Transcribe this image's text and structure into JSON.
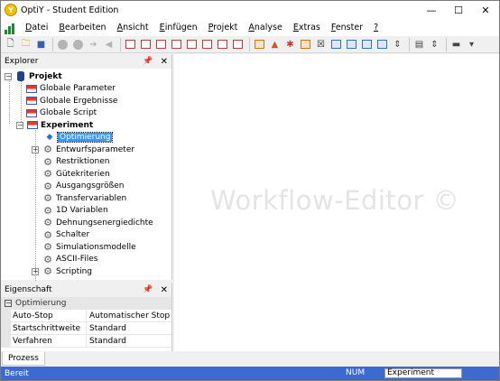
{
  "window": {
    "title": "OptiY - Student Edition",
    "minimize": "—",
    "maximize": "☐",
    "close": "✕"
  },
  "menu": {
    "items": [
      {
        "acc": "D",
        "rest": "atei"
      },
      {
        "acc": "B",
        "rest": "earbeiten"
      },
      {
        "acc": "A",
        "rest": "nsicht"
      },
      {
        "acc": "E",
        "rest": "infügen"
      },
      {
        "acc": "P",
        "rest": "rojekt"
      },
      {
        "acc": "A",
        "rest": "nalyse"
      },
      {
        "acc": "E",
        "rest": "xtras"
      },
      {
        "acc": "F",
        "rest": "enster"
      },
      {
        "acc": "?",
        "rest": ""
      }
    ]
  },
  "explorer": {
    "title": "Explorer",
    "pin": "📌",
    "close": "✕",
    "tree": {
      "project": "Projekt",
      "global_params": "Globale Parameter",
      "global_results": "Globale Ergebnisse",
      "global_script": "Globale Script",
      "experiment": "Experiment",
      "optimization": "Optimierung",
      "children": [
        "Entwurfsparameter",
        "Restriktionen",
        "Gütekriterien",
        "Ausgangsgrößen",
        "Transfervariablen",
        "1D Variablen",
        "Dehnungsenergiedichte",
        "Schalter",
        "Simulationsmodelle",
        "ASCII-Files",
        "Scripting"
      ]
    }
  },
  "properties": {
    "title": "Eigenschaft",
    "group": "Optimierung",
    "rows": [
      {
        "key": "Auto-Stop",
        "value": "Automatischer Stop"
      },
      {
        "key": "Startschrittweite",
        "value": "Standard"
      },
      {
        "key": "Verfahren",
        "value": "Standard"
      }
    ]
  },
  "editor": {
    "watermark": "Workflow-Editor ©"
  },
  "bottom_tab": "Prozess",
  "status": {
    "text": "Bereit",
    "num": "NUM",
    "context": "Experiment"
  },
  "colors": {
    "status_bar": "#3c6ad0",
    "selection": "#3399ff"
  }
}
